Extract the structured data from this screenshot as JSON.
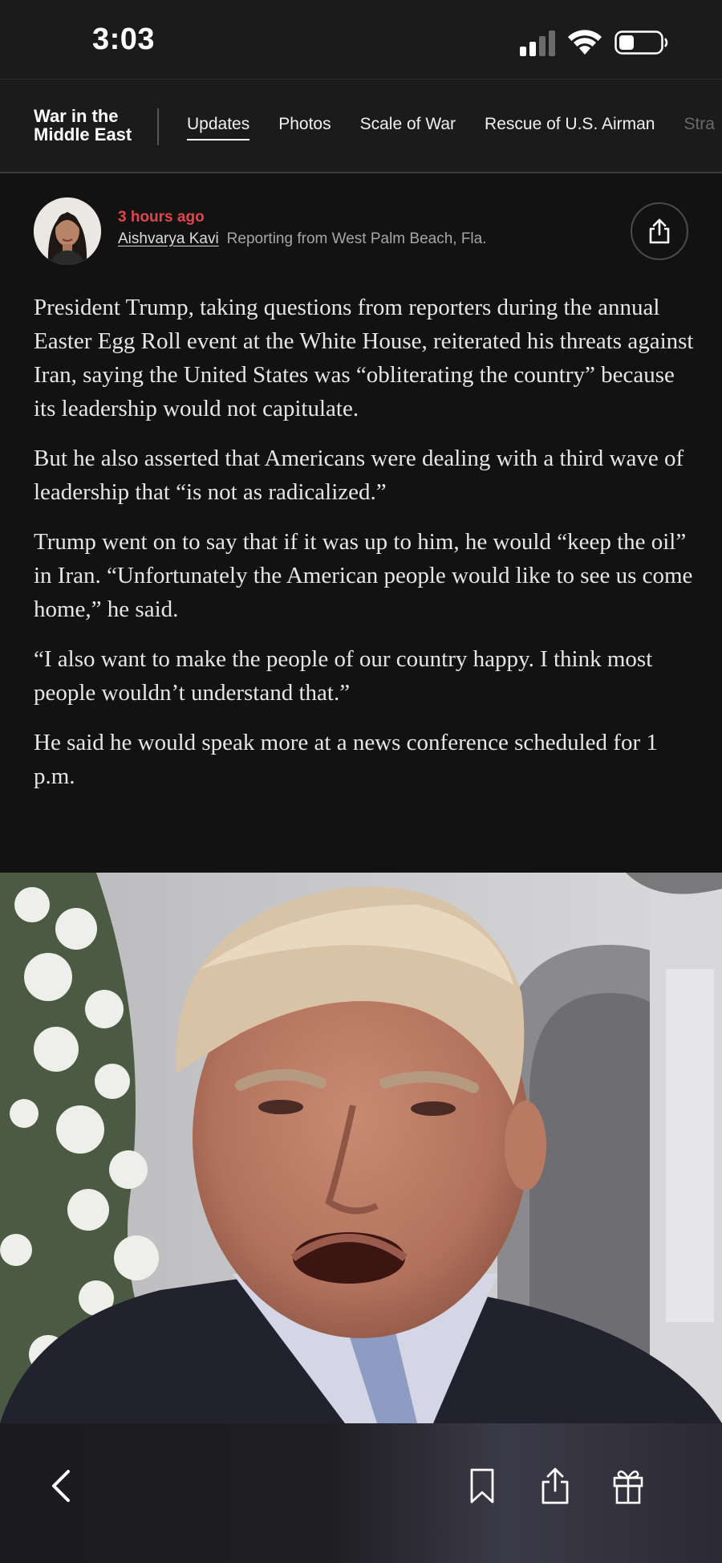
{
  "status_bar": {
    "time": "3:03"
  },
  "section_nav": {
    "title": "War in the Middle East",
    "tabs": [
      {
        "label": "Updates",
        "active": true
      },
      {
        "label": "Photos",
        "active": false
      },
      {
        "label": "Scale of War",
        "active": false
      },
      {
        "label": "Rescue of U.S. Airman",
        "active": false
      },
      {
        "label": "Stra",
        "active": false
      }
    ]
  },
  "byline": {
    "time_ago": "3 hours ago",
    "author": "Aishvarya Kavi",
    "location": "Reporting from West Palm Beach, Fla."
  },
  "article": {
    "paragraphs": [
      "President Trump, taking questions from reporters during the annual Easter Egg Roll event at the White House, reiterated his threats against Iran, saying the United States was “obliterating the country” because its leadership would not capitulate.",
      "But he also asserted that Americans were dealing with a third wave of leadership that “is not as radicalized.”",
      "Trump went on to say that if it was up to him, he would “keep the oil” in Iran. “Unfortunately the American people would like to see us come home,” he said.",
      "“I also want to make the people of our country happy. I think most people wouldn’t understand that.”",
      "He said he would speak more at a news conference scheduled for 1 p.m."
    ]
  },
  "colors": {
    "background": "#121212",
    "accent_red": "#e2454b",
    "nav_background": "#1b1b1b"
  },
  "icons": {
    "back": "chevron-left-icon",
    "bookmark": "bookmark-icon",
    "share": "share-icon",
    "gift": "gift-icon"
  }
}
